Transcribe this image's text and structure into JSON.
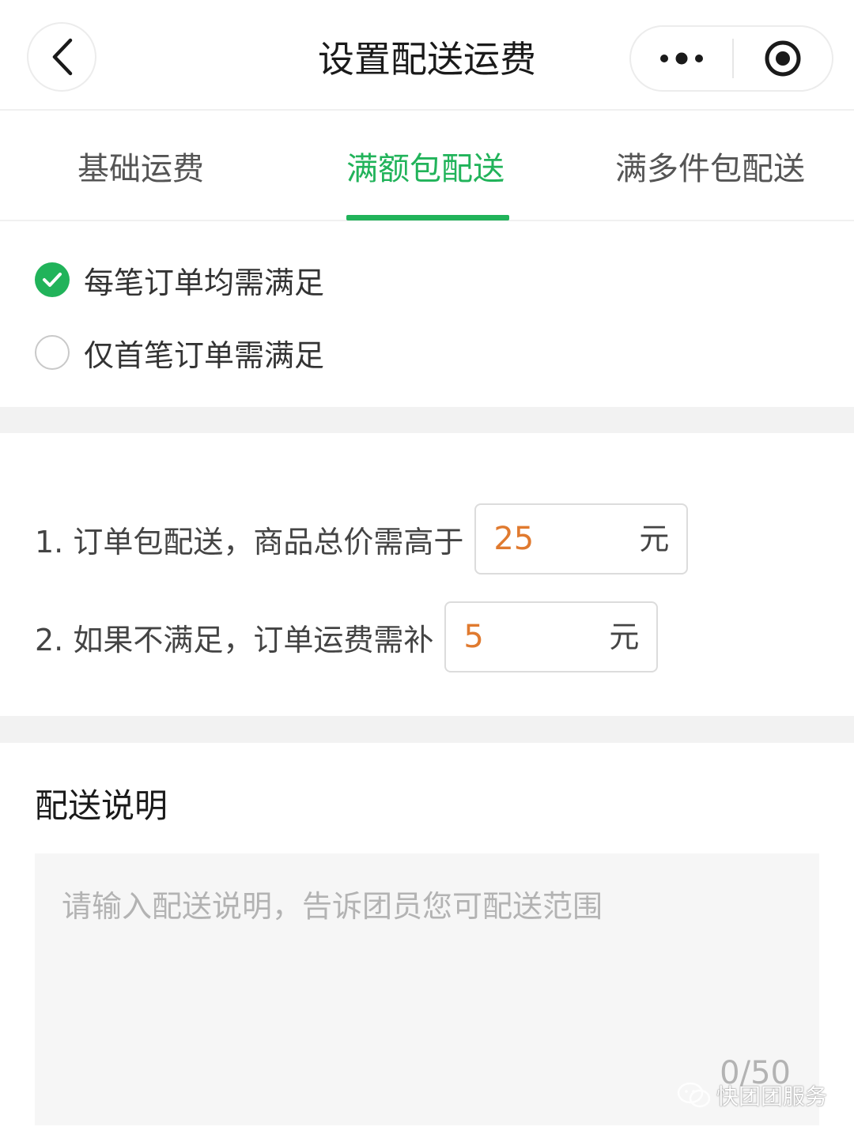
{
  "navbar": {
    "title": "设置配送运费"
  },
  "tabs": [
    {
      "label": "基础运费",
      "active": false
    },
    {
      "label": "满额包配送",
      "active": true
    },
    {
      "label": "满多件包配送",
      "active": false
    }
  ],
  "scope_options": [
    {
      "label": "每笔订单均需满足",
      "checked": true
    },
    {
      "label": "仅首笔订单需满足",
      "checked": false
    }
  ],
  "rules": {
    "threshold": {
      "label": "1. 订单包配送，商品总价需高于",
      "value": "25",
      "unit": "元"
    },
    "surcharge": {
      "label": "2. 如果不满足，订单运费需补",
      "value": "5",
      "unit": "元"
    }
  },
  "description": {
    "title": "配送说明",
    "placeholder": "请输入配送说明，告诉团员您可配送范围",
    "counter": "0/50"
  },
  "watermark": {
    "text": "快团团服务"
  },
  "colors": {
    "accent": "#21b35a",
    "value": "#e07a2f",
    "section_gap": "#f2f2f2"
  }
}
